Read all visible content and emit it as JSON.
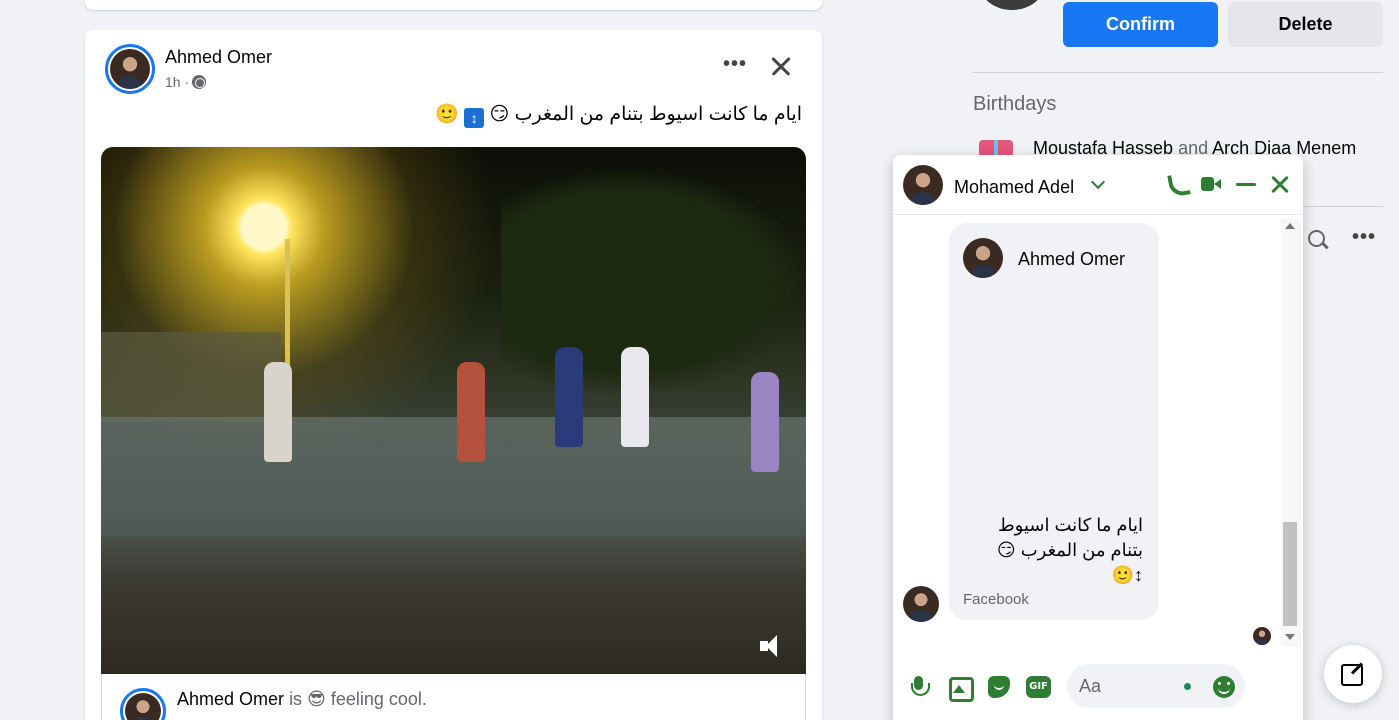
{
  "post": {
    "author": "Ahmed Omer",
    "time": "1h ·",
    "text": "ايام ما كانت اسيوط بتنام من المغرب",
    "text_emojis": [
      "😏",
      "↕",
      "🙂"
    ],
    "more_label": "•••",
    "shared_author": "Ahmed Omer",
    "shared_is": "is",
    "shared_feeling_emoji": "😎",
    "shared_feeling": "feeling cool."
  },
  "friend_request": {
    "confirm_label": "Confirm",
    "delete_label": "Delete"
  },
  "birthdays": {
    "heading": "Birthdays",
    "name1": "Moustafa Hasseb",
    "joiner": "and",
    "name2": "Arch Diaa Menem"
  },
  "contacts": {
    "more_label": "•••"
  },
  "chat": {
    "contact_name": "Mohamed Adel",
    "shared_post_author": "Ahmed Omer",
    "shared_text_line1": "ايام ما كانت اسيوط",
    "shared_text_line2": "بتنام من المغرب 😏",
    "shared_text_line3": "↕🙂",
    "shared_source": "Facebook",
    "input_placeholder": "Aa"
  },
  "colors": {
    "accent": "#1877f2",
    "messenger_green": "#2e7d32",
    "background": "#f0f2f5"
  }
}
